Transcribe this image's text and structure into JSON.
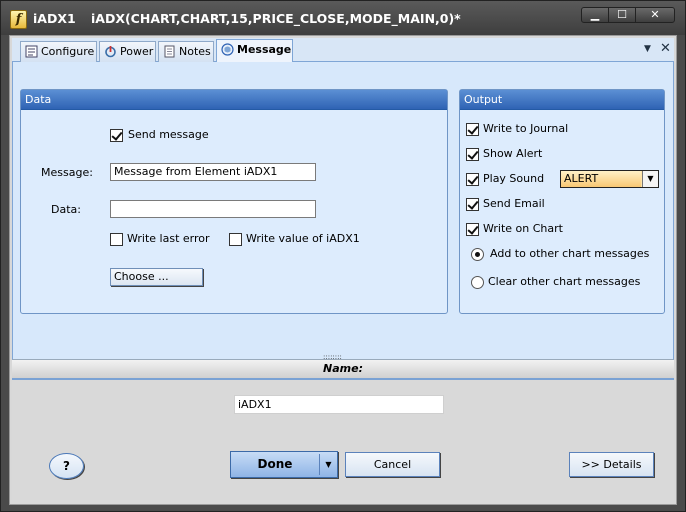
{
  "window": {
    "name": "iADX1",
    "formula": "iADX(CHART,CHART,15,PRICE_CLOSE,MODE_MAIN,0)*",
    "app_icon_letter": "f",
    "minimize_glyph": "▁",
    "maximize_glyph": "☐",
    "close_glyph": "✕"
  },
  "tabs": [
    {
      "label": "Configure",
      "icon": "configure-icon"
    },
    {
      "label": "Power",
      "icon": "power-icon"
    },
    {
      "label": "Notes",
      "icon": "notes-icon"
    },
    {
      "label": "Message",
      "icon": "message-icon",
      "active": true
    }
  ],
  "tab_menu_glyph": "▼",
  "tab_close_glyph": "✕",
  "data_group": {
    "title": "Data",
    "send_message": {
      "label": "Send message",
      "checked": true
    },
    "message_label": "Message:",
    "message_value": "Message from Element iADX1",
    "data_label": "Data:",
    "data_value": "",
    "write_last_error": {
      "label": "Write last error",
      "checked": false
    },
    "write_value": {
      "label": "Write value of iADX1",
      "checked": false
    },
    "choose_button": "Choose ..."
  },
  "output_group": {
    "title": "Output",
    "write_to_journal": {
      "label": "Write to Journal",
      "checked": true
    },
    "show_alert": {
      "label": "Show Alert",
      "checked": true
    },
    "play_sound": {
      "label": "Play Sound",
      "checked": true
    },
    "sound_value": "ALERT",
    "send_email": {
      "label": "Send Email",
      "checked": true
    },
    "write_on_chart": {
      "label": "Write on Chart",
      "checked": true
    },
    "add_to_other": {
      "label": "Add to other chart messages",
      "selected": true
    },
    "clear_other": {
      "label": "Clear other chart messages",
      "selected": false
    }
  },
  "splitter_grip": "::::::::",
  "name_section": {
    "header": "Name:",
    "value": "iADX1"
  },
  "buttons": {
    "help": "?",
    "done": "Done",
    "done_arrow": "▼",
    "cancel": "Cancel",
    "details": ">> Details"
  },
  "colors": {
    "group_header": "#2f63b4",
    "panel_bg": "#d7e8fb",
    "combo_bg": "#f8c773"
  }
}
